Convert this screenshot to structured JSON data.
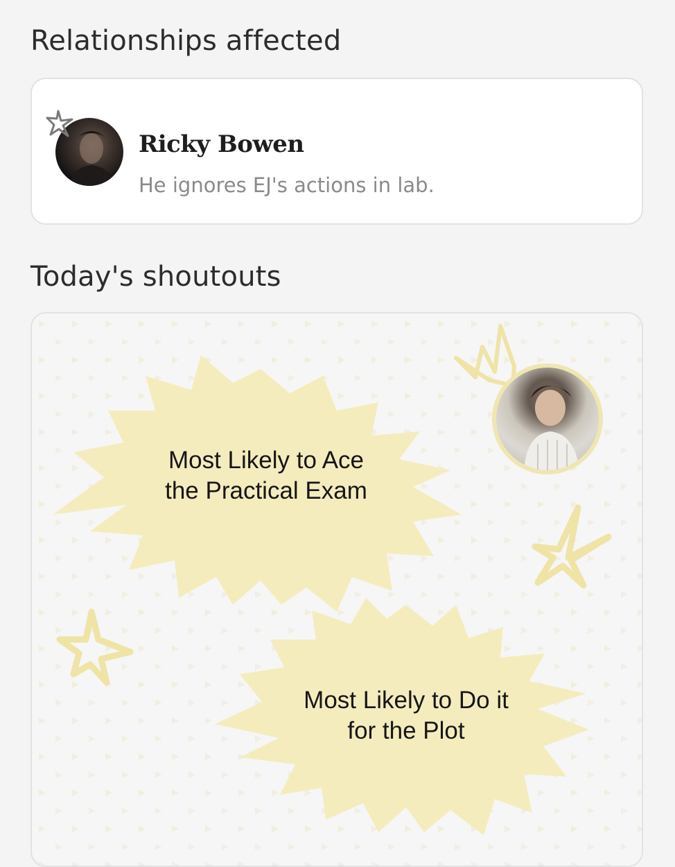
{
  "relationships": {
    "section_title": "Relationships affected",
    "items": [
      {
        "name": "Ricky Bowen",
        "description": "He ignores EJ's actions in lab."
      }
    ]
  },
  "shoutouts": {
    "section_title": "Today's shoutouts",
    "items": [
      {
        "text": "Most Likely to Ace the Practical Exam"
      },
      {
        "text": "Most Likely to Do it for the Plot"
      }
    ]
  },
  "colors": {
    "page_bg": "#f4f4f4",
    "card_bg": "#ffffff",
    "burst_fill": "#f5ecbe",
    "doodle_yellow": "#efe3a6"
  },
  "icons": [
    "star-doodle-icon",
    "crown-doodle-icon"
  ]
}
